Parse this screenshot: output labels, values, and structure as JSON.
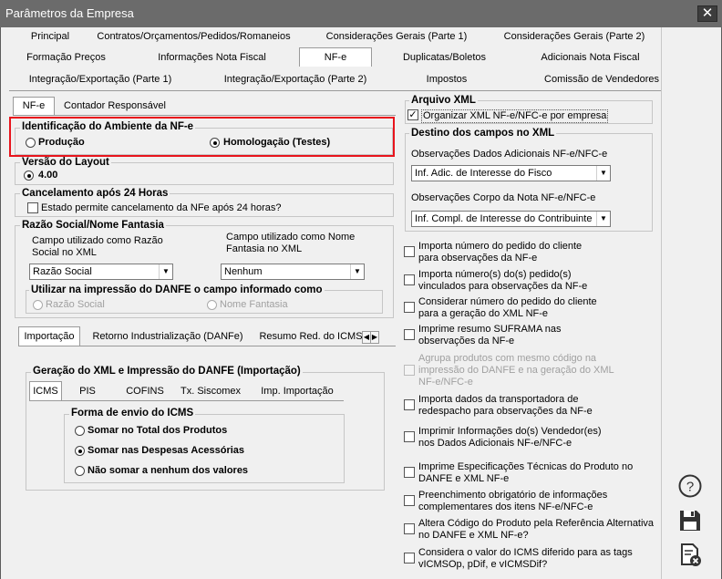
{
  "window": {
    "title": "Parâmetros da Empresa",
    "close_glyph": "✕"
  },
  "main_tabs": {
    "row1": [
      "Principal",
      "Contratos/Orçamentos/Pedidos/Romaneios",
      "Considerações Gerais (Parte 1)",
      "Considerações Gerais (Parte 2)"
    ],
    "row2": [
      "Formação Preços",
      "Informações Nota Fiscal",
      "NF-e",
      "Duplicatas/Boletos",
      "Adicionais Nota Fiscal"
    ],
    "row3": [
      "Integração/Exportação  (Parte 1)",
      "Integração/Exportação (Parte 2)",
      "Impostos",
      "Comissão de Vendedores"
    ],
    "selected": "NF-e"
  },
  "sub_tabs": [
    "NF-e",
    "Contador Responsável"
  ],
  "ambiente": {
    "title": "Identificação do Ambiente da NF-e",
    "producao": "Produção",
    "homologacao": "Homologação (Testes)",
    "selected": "homologacao",
    "highlight_color": "#e8141c"
  },
  "versao": {
    "title": "Versão do Layout",
    "option": "4.00"
  },
  "cancelamento": {
    "title": "Cancelamento após 24 Horas",
    "checkbox": "Estado permite cancelamento da NFe após 24 horas?",
    "checked": false
  },
  "razao": {
    "title": "Razão Social/Nome Fantasia",
    "campo_razao_line1": "Campo utilizado como Razão",
    "campo_razao_line2": "Social no XML",
    "campo_nome_line1": "Campo utilizado como Nome",
    "campo_nome_line2": "Fantasia no XML",
    "razao_value": "Razão Social",
    "nome_value": "Nenhum",
    "danfe_title": "Utilizar na impressão do DANFE o campo informado como",
    "danfe_opt1": "Razão Social",
    "danfe_opt2": "Nome Fantasia"
  },
  "bottom_tabs": [
    "Importação",
    "Retorno Industrialização (DANFe)",
    "Resumo Red. do ICMS"
  ],
  "importacao": {
    "title": "Geração do XML e Impressão do DANFE (Importação)",
    "tabs": [
      "ICMS",
      "PIS",
      "COFINS",
      "Tx. Siscomex",
      "Imp. Importação"
    ],
    "forma_title": "Forma de envio do ICMS",
    "options": [
      "Somar no Total dos Produtos",
      "Somar nas Despesas Acessórias",
      "Não somar a nenhum dos valores"
    ],
    "selected": 1
  },
  "arquivo_xml": {
    "title": "Arquivo XML",
    "checkbox": "Organizar XML NF-e/NFC-e por empresa",
    "checked": true
  },
  "destino": {
    "title": "Destino dos campos no XML",
    "obs_adic_label": "Observações Dados Adicionais NF-e/NFC-e",
    "obs_adic_value": "Inf. Adic. de Interesse do Fisco",
    "obs_corpo_label": "Observações Corpo da Nota NF-e/NFC-e",
    "obs_corpo_value": "Inf. Compl. de Interesse do Contribuinte"
  },
  "options_list": [
    {
      "l1": "Importa número do pedido do cliente",
      "l2": "para observações da NF-e",
      "l3": "",
      "checked": false,
      "disabled": false
    },
    {
      "l1": "Importa número(s) do(s) pedido(s)",
      "l2": "vinculados para observações da NF-e",
      "l3": "",
      "checked": false,
      "disabled": false
    },
    {
      "l1": "Considerar número do pedido do cliente",
      "l2": "para a geração do XML NF-e",
      "l3": "",
      "checked": false,
      "disabled": false
    },
    {
      "l1": "Imprime resumo SUFRAMA nas",
      "l2": "observações da NF-e",
      "l3": "",
      "checked": false,
      "disabled": false
    },
    {
      "l1": "Agrupa produtos com  mesmo código na",
      "l2": "impressão do DANFE e na geração do XML",
      "l3": "NF-e/NFC-e",
      "checked": false,
      "disabled": true
    },
    {
      "l1": "Importa dados da transportadora de",
      "l2": "redespacho para observações da NF-e",
      "l3": "",
      "checked": false,
      "disabled": false
    },
    {
      "l1": "Imprimir Informações do(s) Vendedor(es)",
      "l2": "nos Dados Adicionais NF-e/NFC-e",
      "l3": "",
      "checked": false,
      "disabled": false
    },
    {
      "l1": "Imprime Especificações Técnicas do Produto no",
      "l2": "DANFE e XML NF-e",
      "l3": "",
      "checked": false,
      "disabled": false
    },
    {
      "l1": "Preenchimento obrigatório de informações",
      "l2": "complementares dos itens NF-e/NFC-e",
      "l3": "",
      "checked": false,
      "disabled": false
    },
    {
      "l1": "Altera Código do Produto pela Referência Alternativa",
      "l2": "no DANFE e XML NF-e?",
      "l3": "",
      "checked": false,
      "disabled": false
    },
    {
      "l1": "Considera o valor do ICMS diferido para as tags",
      "l2": "vICMSOp, pDif, e vICMSDif?",
      "l3": "",
      "checked": false,
      "disabled": false
    }
  ],
  "side_icons": [
    "help-icon",
    "save-icon",
    "cancel-document-icon"
  ]
}
